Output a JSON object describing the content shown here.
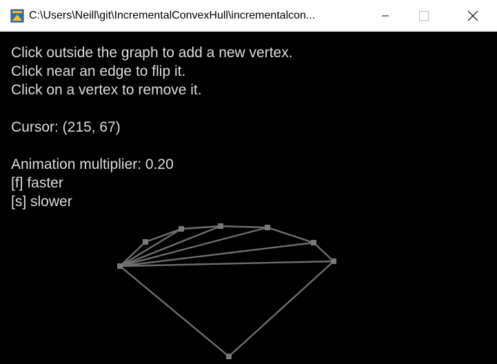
{
  "window": {
    "title": "C:\\Users\\Neill\\git\\IncrementalConvexHull\\incrementalcon..."
  },
  "instructions": {
    "line1": "Click outside the graph to add a new vertex.",
    "line2": "Click near an edge to flip it.",
    "line3": "Click on a vertex to remove it."
  },
  "cursor_label": "Cursor: (215, 67)",
  "animation": {
    "multiplier_label": "Animation multiplier: 0.20",
    "faster_label": "[f] faster",
    "slower_label": "[s] slower"
  },
  "colors": {
    "background": "#000000",
    "text": "#dcdcdc",
    "edge": "#6e6e6e",
    "vertex": "#7a7a7a"
  },
  "icons": [
    "app-icon",
    "minimize-icon",
    "maximize-icon",
    "close-icon"
  ]
}
